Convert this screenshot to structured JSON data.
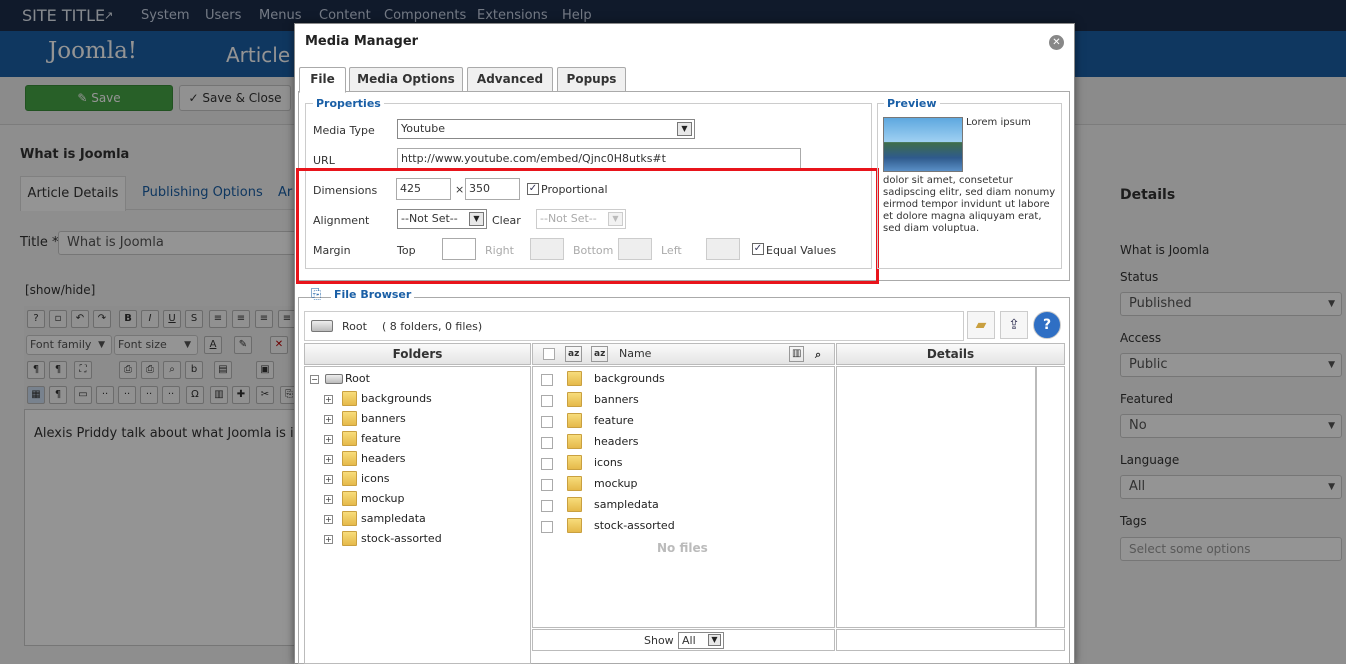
{
  "bg": {
    "site_title": "SITE TITLE",
    "menu": [
      "System",
      "Users",
      "Menus",
      "Content",
      "Components",
      "Extensions",
      "Help"
    ],
    "logo": "Joomla!",
    "header_title": "Article M",
    "save_label": "Save",
    "save_close_label": "Save & Close",
    "page_heading": "What is Joomla",
    "tabs": [
      "Article Details",
      "Publishing Options",
      "Ar"
    ],
    "title_label": "Title *",
    "title_value": "What is Joomla",
    "showhide": "[show/hide]",
    "font_family": "Font family",
    "font_size": "Font size",
    "editor_text": "Alexis Priddy talk about what Joomla is i",
    "details": {
      "heading": "Details",
      "name": "What is Joomla",
      "status_label": "Status",
      "status_value": "Published",
      "access_label": "Access",
      "access_value": "Public",
      "featured_label": "Featured",
      "featured_value": "No",
      "language_label": "Language",
      "language_value": "All",
      "tags_label": "Tags",
      "tags_placeholder": "Select some options"
    }
  },
  "dialog": {
    "title": "Media Manager",
    "tabs": [
      "File",
      "Media Options",
      "Advanced",
      "Popups"
    ],
    "properties": {
      "legend": "Properties",
      "media_type_label": "Media Type",
      "media_type_value": "Youtube",
      "url_label": "URL",
      "url_value": "http://www.youtube.com/embed/Qjnc0H8utks#t",
      "dimensions_label": "Dimensions",
      "width": "425",
      "times": "×",
      "height": "350",
      "proportional_label": "Proportional",
      "proportional_checked": true,
      "alignment_label": "Alignment",
      "alignment_value": "--Not Set--",
      "clear_label": "Clear",
      "clear_value": "--Not Set--",
      "margin_label": "Margin",
      "top_label": "Top",
      "right_label": "Right",
      "bottom_label": "Bottom",
      "left_label": "Left",
      "equal_values_label": "Equal Values",
      "equal_values_checked": true
    },
    "preview": {
      "legend": "Preview",
      "text_lead": "Lorem ipsum",
      "text_body": "dolor sit amet, consetetur sadipscing elitr, sed diam nonumy eirmod tempor invidunt ut labore et dolore magna aliquyam erat, sed diam voluptua."
    },
    "file_browser": {
      "legend": "File Browser",
      "root_label": "Root",
      "summary": "( 8 folders, 0 files)",
      "folders_header": "Folders",
      "name_header": "Name",
      "details_header": "Details",
      "tree_root": "Root",
      "folders": [
        "backgrounds",
        "banners",
        "feature",
        "headers",
        "icons",
        "mockup",
        "sampledata",
        "stock-assorted"
      ],
      "no_files": "No files",
      "show_label": "Show",
      "show_value": "All"
    }
  }
}
